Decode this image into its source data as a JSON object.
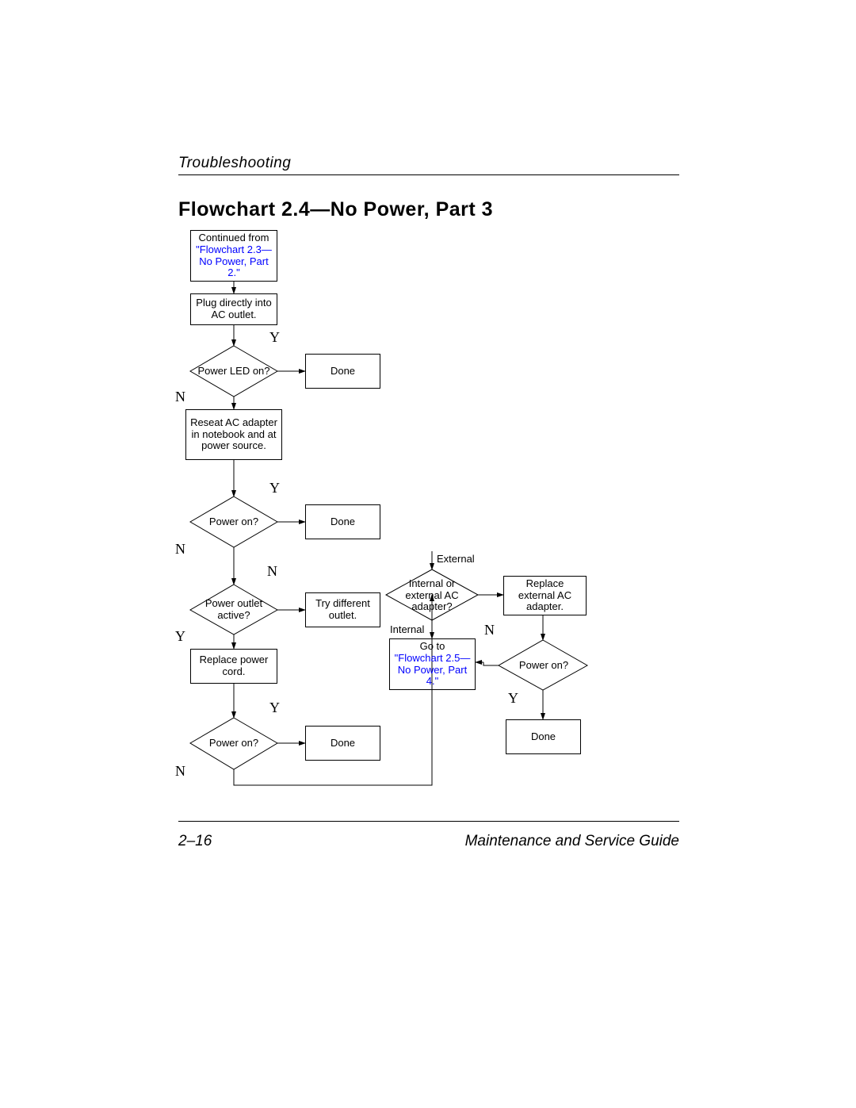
{
  "header": {
    "section": "Troubleshooting"
  },
  "title": "Flowchart 2.4—No Power, Part 3",
  "footer": {
    "pagenum": "2–16",
    "guide": "Maintenance and Service Guide"
  },
  "nodes": {
    "cont_from": {
      "text": "Continued from",
      "link": "\"Flowchart 2.3—No Power, Part 2.\""
    },
    "plug_ac": "Plug directly into AC outlet.",
    "power_led": "Power LED on?",
    "done1": "Done",
    "reseat": "Reseat AC adapter in notebook and at power source.",
    "power_on1": "Power on?",
    "done2": "Done",
    "outlet_active": "Power outlet active?",
    "try_outlet": "Try different outlet.",
    "replace_cord": "Replace power cord.",
    "power_on2": "Power on?",
    "done3": "Done",
    "int_ext": "Internal or external AC adapter?",
    "replace_ext": "Replace external AC adapter.",
    "go_to": {
      "text": "Go to",
      "link": "\"Flowchart 2.5—No Power, Part 4.\""
    },
    "power_on3": "Power on?",
    "done4": "Done"
  },
  "labels": {
    "y": "Y",
    "n": "N",
    "external": "External",
    "internal": "Internal"
  }
}
